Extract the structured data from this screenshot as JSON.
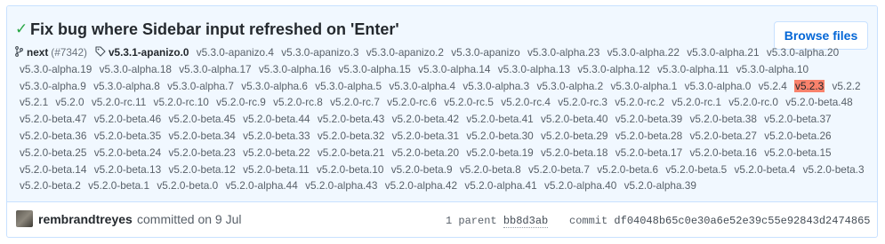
{
  "commit": {
    "title": "Fix bug where Sidebar input refreshed on 'Enter'",
    "browse_label": "Browse files",
    "branch": "next",
    "pr_open": "(",
    "pr_number": "#7342",
    "pr_close": ")",
    "first_tag": "v5.3.1-apanizo.0",
    "highlighted_tag": "v5.2.3",
    "tags_before": [
      "v5.3.0-apanizo.4",
      "v5.3.0-apanizo.3",
      "v5.3.0-apanizo.2",
      "v5.3.0-apanizo",
      "v5.3.0-alpha.23",
      "v5.3.0-alpha.22",
      "v5.3.0-alpha.21",
      "v5.3.0-alpha.20",
      "v5.3.0-alpha.19",
      "v5.3.0-alpha.18",
      "v5.3.0-alpha.17",
      "v5.3.0-alpha.16",
      "v5.3.0-alpha.15",
      "v5.3.0-alpha.14",
      "v5.3.0-alpha.13",
      "v5.3.0-alpha.12",
      "v5.3.0-alpha.11",
      "v5.3.0-alpha.10",
      "v5.3.0-alpha.9",
      "v5.3.0-alpha.8",
      "v5.3.0-alpha.7",
      "v5.3.0-alpha.6",
      "v5.3.0-alpha.5",
      "v5.3.0-alpha.4",
      "v5.3.0-alpha.3",
      "v5.3.0-alpha.2",
      "v5.3.0-alpha.1",
      "v5.3.0-alpha.0",
      "v5.2.4"
    ],
    "tags_after": [
      "v5.2.2",
      "v5.2.1",
      "v5.2.0",
      "v5.2.0-rc.11",
      "v5.2.0-rc.10",
      "v5.2.0-rc.9",
      "v5.2.0-rc.8",
      "v5.2.0-rc.7",
      "v5.2.0-rc.6",
      "v5.2.0-rc.5",
      "v5.2.0-rc.4",
      "v5.2.0-rc.3",
      "v5.2.0-rc.2",
      "v5.2.0-rc.1",
      "v5.2.0-rc.0",
      "v5.2.0-beta.48",
      "v5.2.0-beta.47",
      "v5.2.0-beta.46",
      "v5.2.0-beta.45",
      "v5.2.0-beta.44",
      "v5.2.0-beta.43",
      "v5.2.0-beta.42",
      "v5.2.0-beta.41",
      "v5.2.0-beta.40",
      "v5.2.0-beta.39",
      "v5.2.0-beta.38",
      "v5.2.0-beta.37",
      "v5.2.0-beta.36",
      "v5.2.0-beta.35",
      "v5.2.0-beta.34",
      "v5.2.0-beta.33",
      "v5.2.0-beta.32",
      "v5.2.0-beta.31",
      "v5.2.0-beta.30",
      "v5.2.0-beta.29",
      "v5.2.0-beta.28",
      "v5.2.0-beta.27",
      "v5.2.0-beta.26",
      "v5.2.0-beta.25",
      "v5.2.0-beta.24",
      "v5.2.0-beta.23",
      "v5.2.0-beta.22",
      "v5.2.0-beta.21",
      "v5.2.0-beta.20",
      "v5.2.0-beta.19",
      "v5.2.0-beta.18",
      "v5.2.0-beta.17",
      "v5.2.0-beta.16",
      "v5.2.0-beta.15",
      "v5.2.0-beta.14",
      "v5.2.0-beta.13",
      "v5.2.0-beta.12",
      "v5.2.0-beta.11",
      "v5.2.0-beta.10",
      "v5.2.0-beta.9",
      "v5.2.0-beta.8",
      "v5.2.0-beta.7",
      "v5.2.0-beta.6",
      "v5.2.0-beta.5",
      "v5.2.0-beta.4",
      "v5.2.0-beta.3",
      "v5.2.0-beta.2",
      "v5.2.0-beta.1",
      "v5.2.0-beta.0",
      "v5.2.0-alpha.44",
      "v5.2.0-alpha.43",
      "v5.2.0-alpha.42",
      "v5.2.0-alpha.41",
      "v5.2.0-alpha.40",
      "v5.2.0-alpha.39"
    ],
    "author": "rembrandtreyes",
    "committed_text": "committed on 9 Jul",
    "parent_label": "1 parent",
    "parent_sha": "bb8d3ab",
    "commit_label": "commit",
    "commit_sha": "df04048b65c0e30a6e52e39c55e92843d2474865"
  },
  "icons": {
    "check": "check-icon",
    "branch": "git-branch-icon",
    "tag": "tag-icon"
  },
  "colors": {
    "header_bg": "#f1f8ff",
    "border": "#c8e1ff",
    "link": "#0366d6",
    "check": "#28a745",
    "highlight": "#f9826c"
  }
}
